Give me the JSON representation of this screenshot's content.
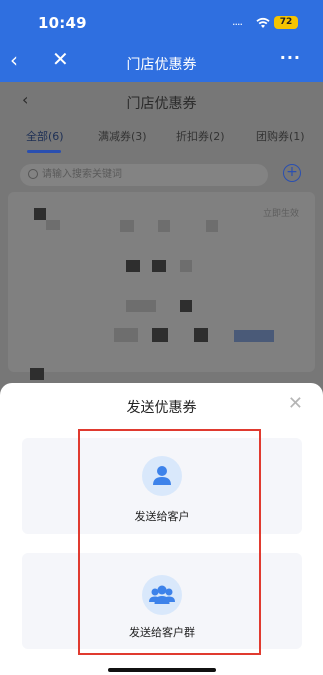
{
  "status_bar": {
    "time": "10:49",
    "signal": "....",
    "battery": "72"
  },
  "app_bar": {
    "title": "门店优惠券"
  },
  "background_page": {
    "title": "门店优惠券",
    "tabs": [
      {
        "label": "全部(6)",
        "active": true
      },
      {
        "label": "满减券(3)",
        "active": false
      },
      {
        "label": "折扣券(2)",
        "active": false
      },
      {
        "label": "团购券(1)",
        "active": false
      }
    ],
    "search_placeholder": "请输入搜索关键词",
    "card_status": "立即生效"
  },
  "sheet": {
    "title": "发送优惠券",
    "options": [
      {
        "label": "发送给客户",
        "icon": "person-icon"
      },
      {
        "label": "发送给客户群",
        "icon": "group-icon"
      }
    ]
  },
  "colors": {
    "brand": "#2f6fe0",
    "icon_blue": "#3d82ea",
    "icon_bg": "#d9e8fb",
    "highlight": "#e03a2f"
  }
}
